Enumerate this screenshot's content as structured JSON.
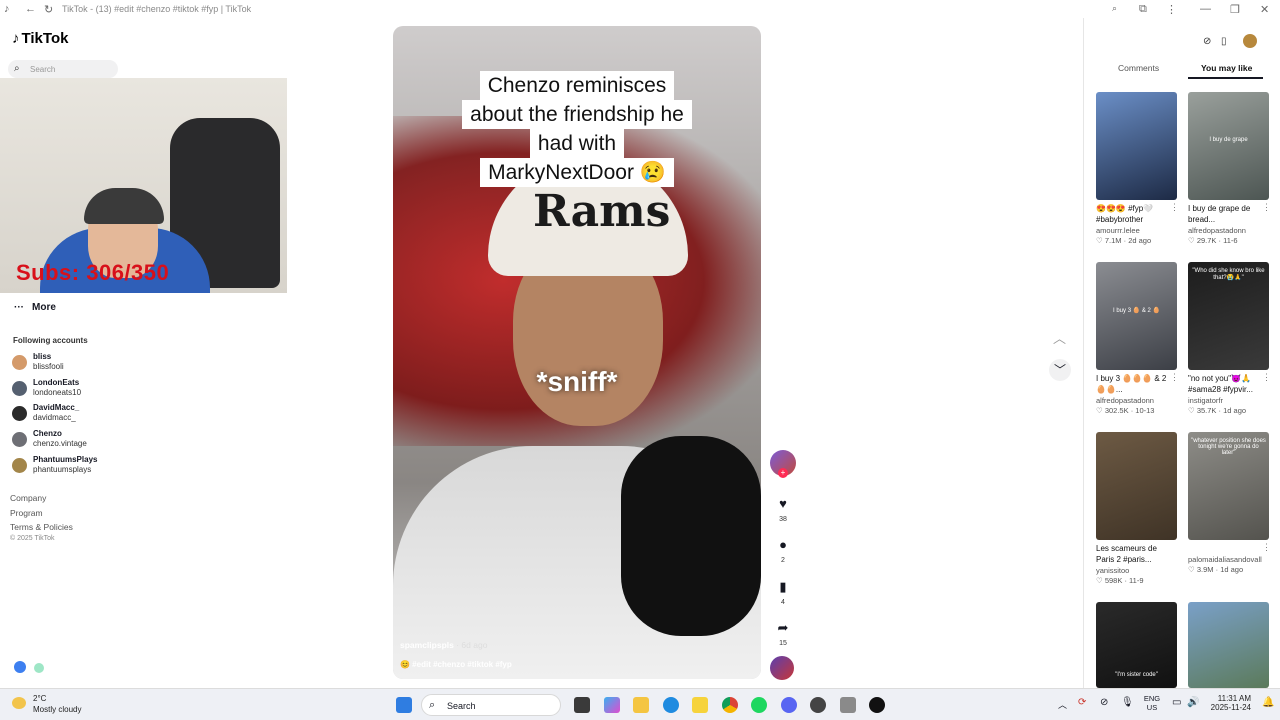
{
  "browser": {
    "tab_title": "TikTok - (13) #edit #chenzo #tiktok #fyp | TikTok"
  },
  "sidebar": {
    "logo": "TikTok",
    "search_placeholder": "Search",
    "webcam_overlay": "Subs: 306/350",
    "more_label": "More",
    "following_heading": "Following accounts",
    "accounts": [
      {
        "name": "bliss",
        "handle": "blissfooli"
      },
      {
        "name": "LondonEats",
        "handle": "londoneats10"
      },
      {
        "name": "DavidMacc_",
        "handle": "davidmacc_"
      },
      {
        "name": "Chenzo",
        "handle": "chenzo.vintage"
      },
      {
        "name": "PhantuumsPlays",
        "handle": "phantuumsplays"
      }
    ],
    "footer_links": [
      "Company",
      "Program",
      "Terms & Policies"
    ],
    "copyright": "© 2025 TikTok"
  },
  "video": {
    "caption_lines": [
      "Chenzo reminisces",
      "about the friendship he",
      "had with",
      "MarkyNextDoor 😢"
    ],
    "overlay_text": "*sniff*",
    "hat_text": "Rams",
    "author": "spamclipspls",
    "posted": "· 6d ago",
    "tags": "😊 #edit #chenzo #tiktok #fyp",
    "actions": {
      "likes": "38",
      "comments": "2",
      "saves": "4",
      "shares": "15"
    }
  },
  "right_panel": {
    "tabs": [
      "Comments",
      "You may like"
    ],
    "active_tab": "You may like",
    "cards": [
      {
        "title": "😍😍😍 #fyp🤍 #babybrother",
        "author": "amourrr.lelee",
        "likes": "7.1M",
        "age": "2d ago",
        "overlay": "",
        "colors": [
          "#6b8fc7",
          "#1d2a45"
        ]
      },
      {
        "title": "I buy de grape de bread...",
        "author": "alfredopastadonn",
        "likes": "29.7K",
        "age": "11-6",
        "overlay": "I buy de grape",
        "colors": [
          "#9aa09c",
          "#4d5653"
        ]
      },
      {
        "title": "I buy 3 🥚🥚🥚 & 2 🥚🥚...",
        "author": "alfredopastadonn",
        "likes": "302.5K",
        "age": "10-13",
        "overlay": "I buy 3 🥚 & 2 🥚",
        "colors": [
          "#8b8d92",
          "#3c3f46"
        ]
      },
      {
        "title": "\"no not you\"😈🙏 #sama28 #fypvir...",
        "author": "instigatorfr",
        "likes": "35.7K",
        "age": "1d ago",
        "overlay": "\"Who did she know bro like that?😭🙏\"",
        "colors": [
          "#1d1d1d",
          "#3a3a3a"
        ]
      },
      {
        "title": "Les scameurs de Paris 2 #paris...",
        "author": "yanissitoo",
        "likes": "598K",
        "age": "11-9",
        "overlay": "",
        "colors": [
          "#6d5a44",
          "#3f3326"
        ]
      },
      {
        "title": "",
        "author": "palomaidaliasandovall",
        "likes": "3.9M",
        "age": "1d ago",
        "overlay": "\"whatever position she does tonight we're gonna do later\"",
        "colors": [
          "#8e8d88",
          "#54534e"
        ]
      },
      {
        "title": "",
        "author": "",
        "likes": "",
        "age": "",
        "overlay": "\"I'm sister code\"",
        "colors": [
          "#2a2a2a",
          "#111"
        ]
      },
      {
        "title": "",
        "author": "",
        "likes": "",
        "age": "",
        "overlay": "",
        "colors": [
          "#7aa0c8",
          "#5b7a5a"
        ]
      }
    ]
  },
  "taskbar": {
    "weather_temp": "2°C",
    "weather_desc": "Mostly cloudy",
    "search_label": "Search",
    "lang_line1": "ENG",
    "lang_line2": "US",
    "time": "11:31 AM",
    "date": "2025-11-24"
  }
}
